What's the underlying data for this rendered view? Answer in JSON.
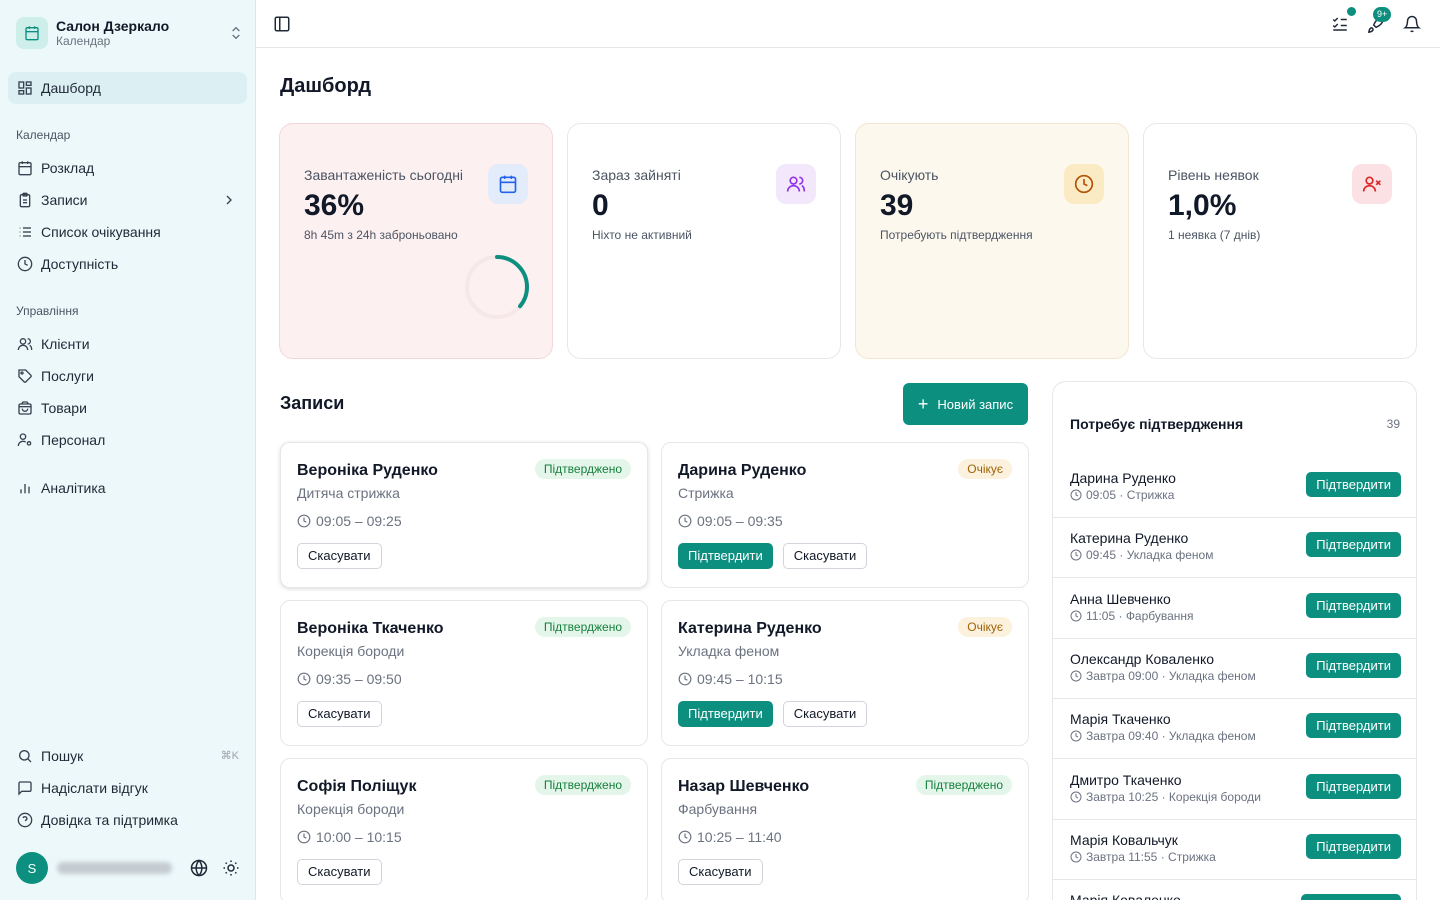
{
  "org": {
    "name": "Салон Дзеркало",
    "subtitle": "Календар"
  },
  "sidebar": {
    "dashboard": "Дашборд",
    "section_calendar": "Календар",
    "schedule": "Розклад",
    "records": "Записи",
    "waitlist": "Список очікування",
    "availability": "Доступність",
    "section_manage": "Управління",
    "clients": "Клієнти",
    "services": "Послуги",
    "products": "Товари",
    "staff": "Персонал",
    "analytics": "Аналітика",
    "search": "Пошук",
    "search_shortcut": "⌘K",
    "feedback": "Надіслати відгук",
    "help": "Довідка та підтримка",
    "user_initial": "S"
  },
  "topbar": {
    "badge": "9+"
  },
  "page_title": "Дашборд",
  "stats": [
    {
      "label": "Завантаженість сьогодні",
      "value": "36%",
      "sub": "8h 45m з 24h заброньовано",
      "progress": 0.36
    },
    {
      "label": "Зараз зайняті",
      "value": "0",
      "sub": "Ніхто не активний"
    },
    {
      "label": "Очікують",
      "value": "39",
      "sub": "Потребують підтвердження"
    },
    {
      "label": "Рівень неявок",
      "value": "1,0%",
      "sub": "1 неявка (7 днів)"
    }
  ],
  "appointments_section": {
    "title": "Записи",
    "new_button": "Новий запис"
  },
  "appointments": [
    {
      "name": "Вероніка Руденко",
      "service": "Дитяча стрижка",
      "time": "09:05 – 09:25",
      "status": "Підтверджено",
      "confirm": "",
      "cancel": "Скасувати"
    },
    {
      "name": "Дарина Руденко",
      "service": "Стрижка",
      "time": "09:05 – 09:35",
      "status": "Очікує",
      "confirm": "Підтвердити",
      "cancel": "Скасувати"
    },
    {
      "name": "Вероніка Ткаченко",
      "service": "Корекція бороди",
      "time": "09:35 – 09:50",
      "status": "Підтверджено",
      "confirm": "",
      "cancel": "Скасувати"
    },
    {
      "name": "Катерина Руденко",
      "service": "Укладка феном",
      "time": "09:45 – 10:15",
      "status": "Очікує",
      "confirm": "Підтвердити",
      "cancel": "Скасувати"
    },
    {
      "name": "Софія Поліщук",
      "service": "Корекція бороди",
      "time": "10:00 – 10:15",
      "status": "Підтверджено",
      "confirm": "",
      "cancel": "Скасувати"
    },
    {
      "name": "Назар Шевченко",
      "service": "Фарбування",
      "time": "10:25 – 11:40",
      "status": "Підтверджено",
      "confirm": "",
      "cancel": "Скасувати"
    }
  ],
  "pending_panel": {
    "title": "Потребує підтвердження",
    "count": "39",
    "items": [
      {
        "name": "Дарина Руденко",
        "when": "09:05",
        "service": "Стрижка",
        "button": "Підтвердити"
      },
      {
        "name": "Катерина Руденко",
        "when": "09:45",
        "service": "Укладка феном",
        "button": "Підтвердити"
      },
      {
        "name": "Анна Шевченко",
        "when": "11:05",
        "service": "Фарбування",
        "button": "Підтвердити"
      },
      {
        "name": "Олександр Коваленко",
        "when": "Завтра 09:00",
        "service": "Укладка феном",
        "button": "Підтвердити"
      },
      {
        "name": "Марія Ткаченко",
        "when": "Завтра 09:40",
        "service": "Укладка феном",
        "button": "Підтвердити"
      },
      {
        "name": "Дмитро Ткаченко",
        "when": "Завтра 10:25",
        "service": "Корекція бороди",
        "button": "Підтвердити"
      },
      {
        "name": "Марія Ковальчук",
        "when": "Завтра 11:55",
        "service": "Стрижка",
        "button": "Підтвердити"
      },
      {
        "name": "Марія Коваленко",
        "when": "",
        "service": "",
        "button": ""
      }
    ]
  },
  "colors": {
    "accent": "#0d8f80",
    "confirmed": "#15803d",
    "pending": "#a16207",
    "sidebar_bg": "#ecf8fa"
  }
}
